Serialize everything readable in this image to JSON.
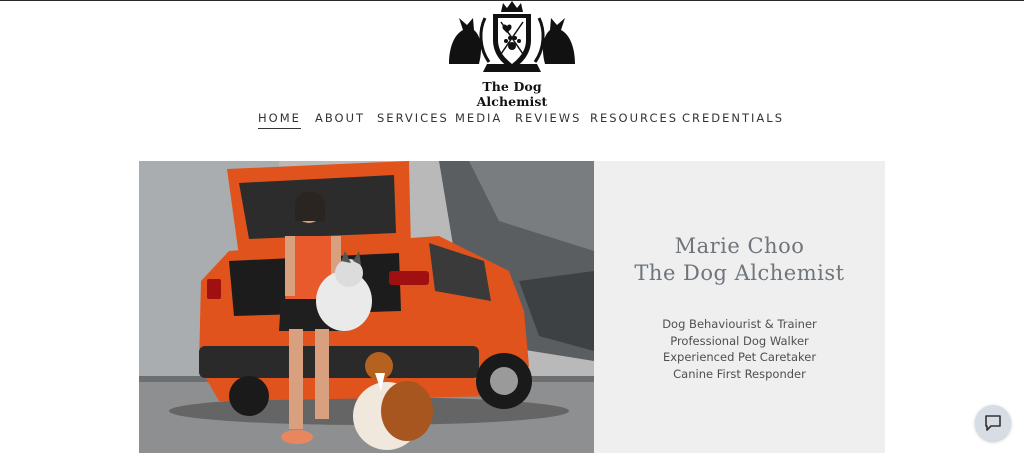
{
  "brand": {
    "logo_text": "The Dog Alchemist"
  },
  "nav": {
    "items": [
      {
        "label": "HOME",
        "active": true
      },
      {
        "label": "ABOUT",
        "active": false
      },
      {
        "label": "SERVICES",
        "active": false
      },
      {
        "label": "MEDIA",
        "active": false
      },
      {
        "label": "REVIEWS",
        "active": false
      },
      {
        "label": "RESOURCES",
        "active": false
      },
      {
        "label": "CREDENTIALS",
        "active": false
      }
    ]
  },
  "hero": {
    "name_line1": "Marie Choo",
    "name_line2": "The Dog Alchemist",
    "roles": [
      "Dog Behaviourist & Trainer",
      "Professional Dog Walker",
      "Experienced Pet Caretaker",
      "Canine First Responder"
    ]
  },
  "colors": {
    "panel_bg": "#efefef",
    "title_color": "#6e757b",
    "car_accent": "#e0531c"
  },
  "icons": {
    "chat": "chat-bubble-icon"
  }
}
